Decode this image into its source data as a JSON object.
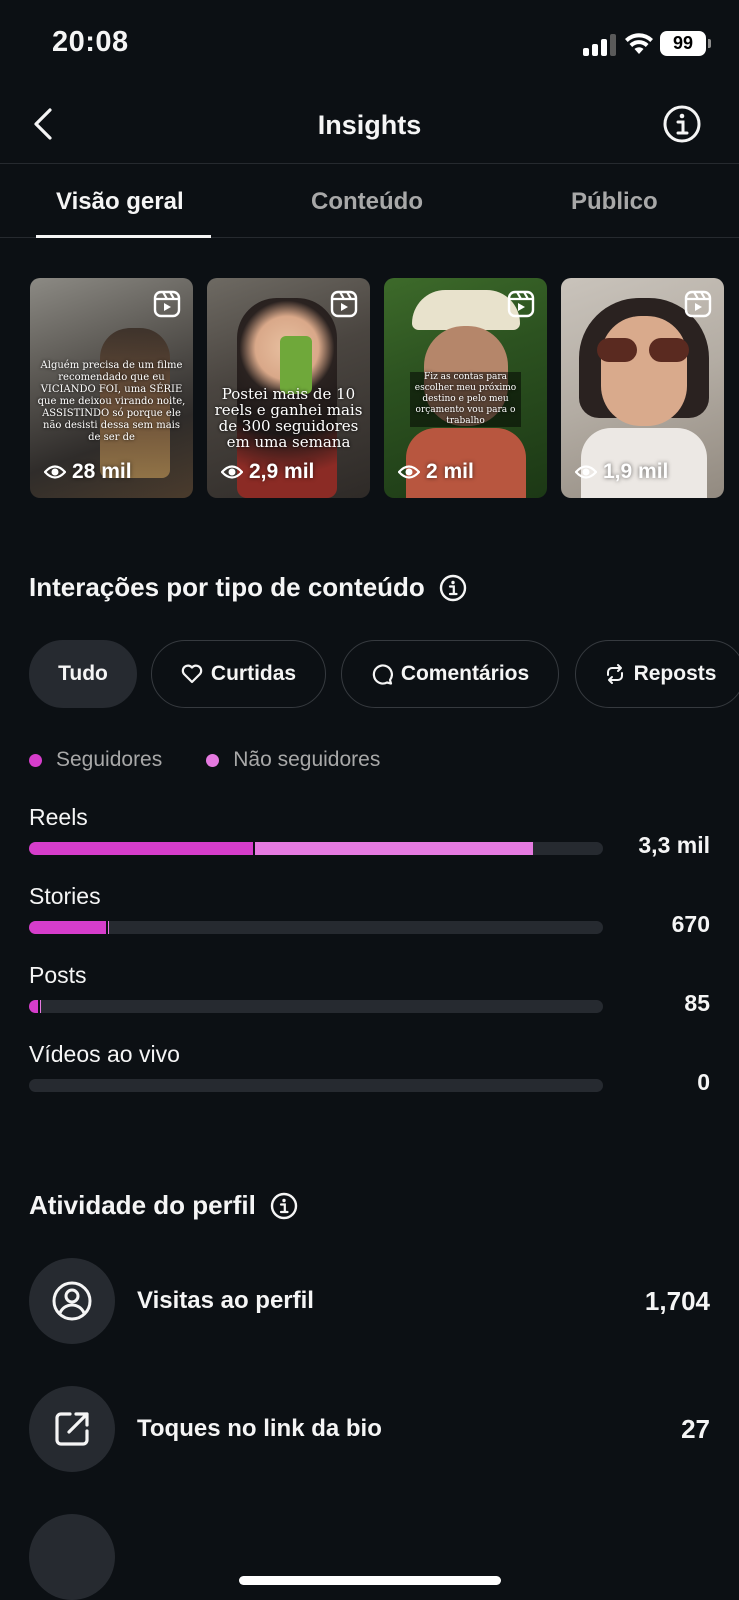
{
  "status": {
    "time": "20:08",
    "battery": "99"
  },
  "header": {
    "title": "Insights"
  },
  "tabs": [
    {
      "label": "Visão geral",
      "active": true
    },
    {
      "label": "Conteúdo",
      "active": false
    },
    {
      "label": "Público",
      "active": false
    }
  ],
  "thumbnails": [
    {
      "views": "28 mil",
      "caption": "Alguém precisa de um filme recomendado que eu VICIANDO FOI, uma SÉRIE que me deixou virando noite, ASSISTINDO só porque ele não desisti dessa sem mais de ser de"
    },
    {
      "views": "2,9 mil",
      "caption": "Postei mais de 10 reels e ganhei mais de 300 seguidores em uma semana"
    },
    {
      "views": "2 mil",
      "caption": "Fiz as contas para escolher meu próximo destino e pelo meu orçamento vou para o trabalho"
    },
    {
      "views": "1,9 mil",
      "caption": ""
    }
  ],
  "interactions": {
    "title": "Interações por tipo de conteúdo",
    "filters": [
      "Tudo",
      "Curtidas",
      "Comentários",
      "Reposts"
    ],
    "legend": {
      "followers": "Seguidores",
      "non_followers": "Não seguidores"
    },
    "colors": {
      "followers": "#d63dcb",
      "non_followers": "#e57ae0",
      "track": "#262a30"
    }
  },
  "chart_data": {
    "type": "bar",
    "stacked": true,
    "orientation": "horizontal",
    "categories": [
      "Reels",
      "Stories",
      "Posts",
      "Vídeos ao vivo"
    ],
    "totals_display": [
      "3,3 mil",
      "670",
      "85",
      "0"
    ],
    "series": [
      {
        "name": "Seguidores",
        "values": [
          1600,
          550,
          65,
          0
        ]
      },
      {
        "name": "Não seguidores",
        "values": [
          2000,
          20,
          10,
          0
        ]
      }
    ],
    "xlim": [
      0,
      4100
    ]
  },
  "activity": {
    "title": "Atividade do perfil",
    "items": [
      {
        "label": "Visitas ao perfil",
        "value": "1,704",
        "icon": "user-circle-icon"
      },
      {
        "label": "Toques no link da bio",
        "value": "27",
        "icon": "external-link-icon"
      }
    ]
  }
}
